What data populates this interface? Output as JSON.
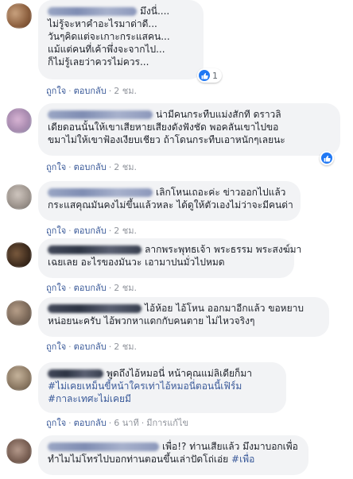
{
  "comments": [
    {
      "lines": [
        "มึงนี่....",
        "ไม่รู้จะหาคำอะไรมาด่าดี...",
        "วันๆคิดแต่จะเกาะกระแสคน...",
        "แม้แต่คนที่เค้าพึ่งจะจากไป...",
        "ก็ไม่รู้เลยว่าควรไม่ควร..."
      ],
      "reaction_count": "1",
      "meta": {
        "like": "ถูกใจ",
        "reply": "ตอบกลับ",
        "time": "2 ชม."
      }
    },
    {
      "lines": [
        "น่ามีคนกระทืบแม่งสักที ดราวลิ",
        "เดียดอนนั้นให้เขาเสียหายเสียงดังฟังชัด พอคลันเขาไปขอ",
        "ขมาไม่ให้เขาฟ้องเงียบเชียว ถ้าโดนกระทืบเอาหนักๆเลยนะ"
      ],
      "reaction_count": "",
      "meta": {
        "like": "ถูกใจ",
        "reply": "ตอบกลับ",
        "time": "2 ชม."
      }
    },
    {
      "lines": [
        "เลิกโหนเถอะค่ะ ข่าวออกไปแล้ว",
        "กระแสคุณมันคงไม่ขึ้นแล้วหละ ได้ดูให้ตัวเองไม่ว่าจะมีคนด่า"
      ],
      "reaction_count": "",
      "meta": {
        "like": "ถูกใจ",
        "reply": "ตอบกลับ",
        "time": "2 ชม."
      }
    },
    {
      "lines": [
        "ลากพระพุทธเจ้า พระธรรม พระสงฆ์มา",
        "เฉยเลย อะไรของมันวะ เอามาปนมั่วไปหมด"
      ],
      "reaction_count": "",
      "meta": {
        "like": "ถูกใจ",
        "reply": "ตอบกลับ",
        "time": "2 ชม."
      }
    },
    {
      "lines": [
        "ไอ้ห้อย ไอ้โหน ออกมาอีกแล้ว ขอหยาบ",
        "หน่อยนะครับ ไอ้พวกหาแดกกับคนตาย ไม่ไหวจริงๆ"
      ],
      "reaction_count": "",
      "meta": {
        "like": "ถูกใจ",
        "reply": "ตอบกลับ",
        "time": "2 ชม."
      }
    },
    {
      "lines": [
        "พูดถึงไอ้หมอนี่ หน้าคุณแม่ลิเดียก็มา"
      ],
      "hashtags": [
        "#ไม่เคยเหม็นขี้หน้าใครเท่าไอ้หมอนี่ตอนนี้เฟิร์ม",
        "#กาละเทศะไม่เคยมี"
      ],
      "reaction_count": "",
      "meta": {
        "like": "ถูกใจ",
        "reply": "ตอบกลับ",
        "time": "6 นาที",
        "edited": "มีการแก้ไข"
      }
    },
    {
      "lines": [
        "เพื่อ!? ท่านเสียแล้ว มึงมาบอกเพื่อ",
        "ทำไมไม่โทรไปบอกท่านตอนขึ้นเล่าปัดโถ่เอ่ย"
      ],
      "inline_hashtag": "#เพื่อ",
      "reaction_count": "",
      "meta": {}
    }
  ],
  "colors": {
    "link": "#385898",
    "meta": "#90949c",
    "bubble": "#f2f3f5",
    "like_badge": "#2078f4"
  },
  "icons": {
    "reaction": "like-icon"
  }
}
